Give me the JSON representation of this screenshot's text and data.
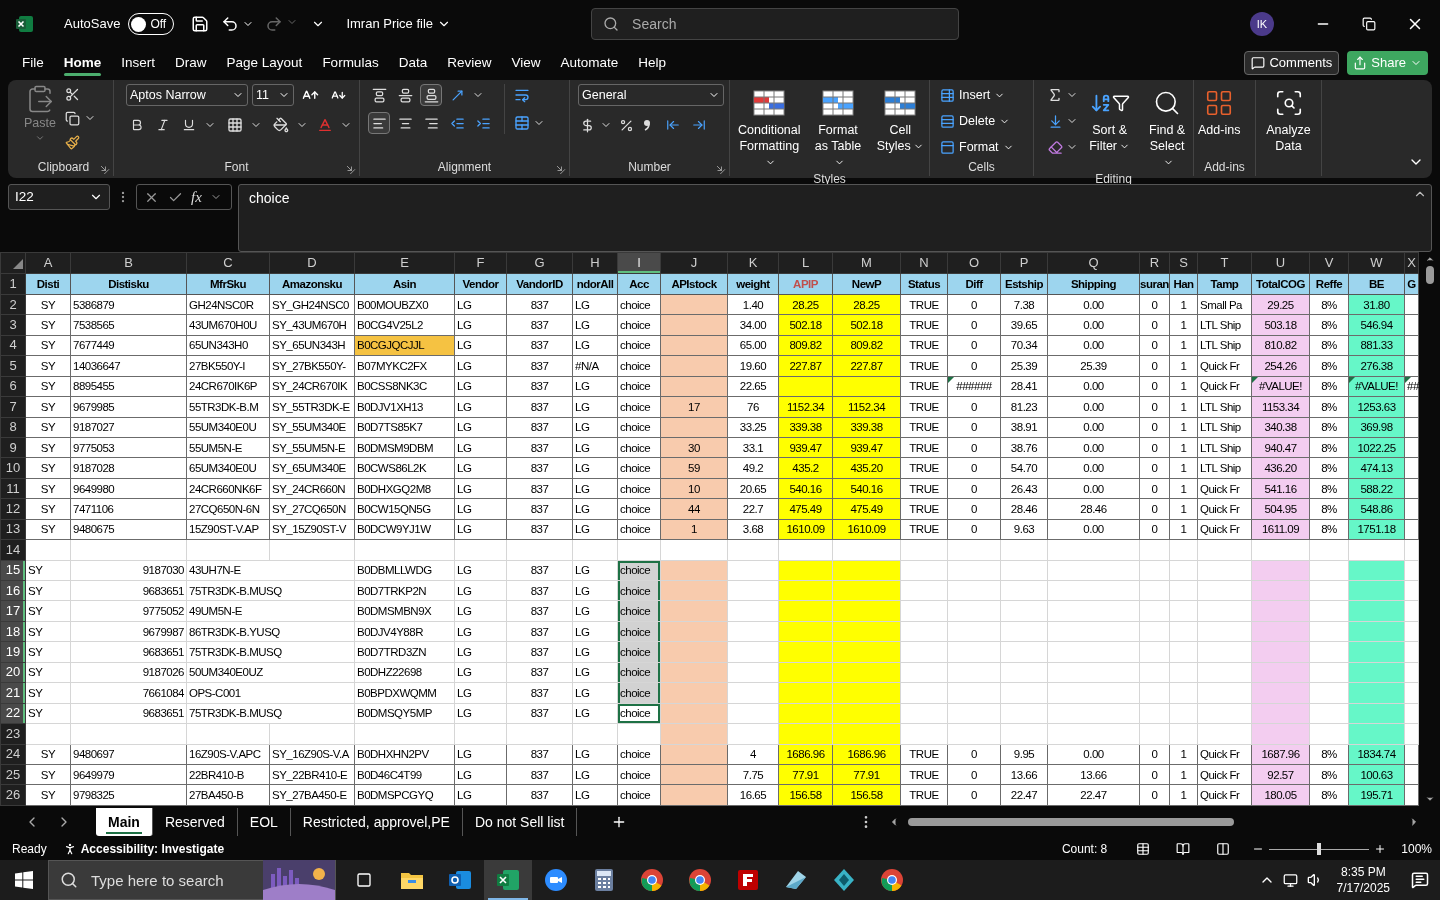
{
  "titlebar": {
    "autosave_label": "AutoSave",
    "autosave_on": false,
    "autosave_state": "Off",
    "file_name": "Imran Price file",
    "search_placeholder": "Search",
    "avatar_initials": "IK"
  },
  "menu_tabs": [
    {
      "label": "File",
      "selected": false
    },
    {
      "label": "Home",
      "selected": true
    },
    {
      "label": "Insert",
      "selected": false
    },
    {
      "label": "Draw",
      "selected": false
    },
    {
      "label": "Page Layout",
      "selected": false
    },
    {
      "label": "Formulas",
      "selected": false
    },
    {
      "label": "Data",
      "selected": false
    },
    {
      "label": "Review",
      "selected": false
    },
    {
      "label": "View",
      "selected": false
    },
    {
      "label": "Automate",
      "selected": false
    },
    {
      "label": "Help",
      "selected": false
    }
  ],
  "comments_button": "Comments",
  "share_button": "Share",
  "ribbon": {
    "clipboard": {
      "title": "Clipboard",
      "paste": "Paste"
    },
    "font": {
      "title": "Font",
      "font_name": "Aptos Narrow",
      "font_size": "11"
    },
    "alignment": {
      "title": "Alignment"
    },
    "number": {
      "title": "Number",
      "format": "General"
    },
    "styles": {
      "title": "Styles",
      "buttons": [
        "Conditional Formatting",
        "Format as Table",
        "Cell Styles"
      ]
    },
    "cells": {
      "title": "Cells",
      "buttons": [
        "Insert",
        "Delete",
        "Format"
      ]
    },
    "editing": {
      "title": "Editing",
      "buttons": [
        "Sort & Filter",
        "Find & Select"
      ]
    },
    "addins": {
      "title": "Add-ins",
      "button": "Add-ins"
    },
    "analyze": {
      "button": "Analyze Data"
    }
  },
  "formula_bar": {
    "name_box": "I22",
    "fx": "fx",
    "formula": "choice"
  },
  "grid": {
    "header_row_number": "1",
    "columns": [
      {
        "letter": "A",
        "header": "Disti",
        "selected": false
      },
      {
        "letter": "B",
        "header": "Distisku",
        "selected": false
      },
      {
        "letter": "C",
        "header": "MfrSku",
        "selected": false
      },
      {
        "letter": "D",
        "header": "Amazonsku",
        "selected": false
      },
      {
        "letter": "E",
        "header": "Asin",
        "selected": false
      },
      {
        "letter": "F",
        "header": "Vendor",
        "selected": false
      },
      {
        "letter": "G",
        "header": "VandorID",
        "selected": false
      },
      {
        "letter": "H",
        "header": "ndorAll",
        "selected": false
      },
      {
        "letter": "I",
        "header": "Acc",
        "selected": true
      },
      {
        "letter": "J",
        "header": "APIstock",
        "selected": false,
        "color": "#f8cbad"
      },
      {
        "letter": "K",
        "header": "weight",
        "selected": false
      },
      {
        "letter": "L",
        "header": {
          "text": "APIP",
          "color": "#c0504d"
        },
        "selected": false,
        "color": "#ffff00"
      },
      {
        "letter": "M",
        "header": "NewP",
        "selected": false,
        "color": "#ffff00"
      },
      {
        "letter": "N",
        "header": "Status",
        "selected": false
      },
      {
        "letter": "O",
        "header": "Diff",
        "selected": false
      },
      {
        "letter": "P",
        "header": "Estship",
        "selected": false
      },
      {
        "letter": "Q",
        "header": "Shipping",
        "selected": false
      },
      {
        "letter": "R",
        "header": "suran",
        "selected": false
      },
      {
        "letter": "S",
        "header": "Han",
        "selected": false
      },
      {
        "letter": "T",
        "header": "Tamp",
        "selected": false
      },
      {
        "letter": "U",
        "header": "TotalCOG",
        "selected": false,
        "color": "#f3cdf0"
      },
      {
        "letter": "V",
        "header": "Reffe",
        "selected": false
      },
      {
        "letter": "W",
        "header": "BE",
        "selected": false,
        "color": "#66f7c8"
      },
      {
        "letter": "X",
        "header": "G",
        "selected": false
      }
    ],
    "rows": [
      {
        "num": "2",
        "kind": "data",
        "filled": true,
        "selected": false,
        "active": false,
        "cells": [
          "SY",
          "5386879",
          "GH24NSC0R",
          "SY_GH24NSC0",
          "B00MOUBZX0",
          "LG",
          "837",
          "LG",
          "choice",
          "",
          "1.40",
          "28.25",
          "28.25",
          "TRUE",
          "0",
          "7.38",
          "0.00",
          "0",
          "1",
          "Small Pa",
          "29.25",
          "8%",
          "31.80"
        ]
      },
      {
        "num": "3",
        "kind": "data",
        "filled": true,
        "selected": false,
        "active": false,
        "cells": [
          "SY",
          "7538565",
          "43UM670H0U",
          "SY_43UM670H",
          "B0CG4V25L2",
          "LG",
          "837",
          "LG",
          "choice",
          "",
          "34.00",
          "502.18",
          "502.18",
          "TRUE",
          "0",
          "39.65",
          "0.00",
          "0",
          "1",
          "LTL Ship",
          "503.18",
          "8%",
          "546.94"
        ]
      },
      {
        "num": "4",
        "kind": "data",
        "filled": true,
        "selected": false,
        "active": false,
        "cells": [
          "SY",
          "7677449",
          "65UN343H0",
          "SY_65UN343H",
          {
            "text": "B0CGJQCJJL",
            "color": "#f5c242"
          },
          "LG",
          "837",
          "LG",
          "choice",
          "",
          "65.00",
          "809.82",
          "809.82",
          "TRUE",
          "0",
          "70.34",
          "0.00",
          "0",
          "1",
          "LTL Ship",
          "810.82",
          "8%",
          "881.33"
        ]
      },
      {
        "num": "5",
        "kind": "data",
        "filled": true,
        "selected": false,
        "active": false,
        "cells": [
          "SY",
          "14036647",
          "27BK550Y-I",
          "SY_27BK550Y-",
          "B07MYKC2FX",
          "LG",
          "837",
          "#N/A",
          "choice",
          "",
          "19.60",
          "227.87",
          "227.87",
          "TRUE",
          "0",
          "25.39",
          "25.39",
          "0",
          "1",
          "Quick Fr",
          "254.26",
          "8%",
          "276.38"
        ]
      },
      {
        "num": "6",
        "kind": "data",
        "filled": true,
        "selected": false,
        "active": false,
        "cells": [
          "SY",
          "8895455",
          "24CR670IK6P",
          "SY_24CR670IK",
          "B0CSS8NK3C",
          "LG",
          "837",
          "LG",
          "choice",
          "",
          "22.65",
          "",
          "",
          "TRUE",
          {
            "text": "######",
            "flag": true
          },
          "28.41",
          "0.00",
          "0",
          "1",
          "Quick Fr",
          {
            "text": "#VALUE!",
            "flag": true
          },
          "8%",
          {
            "text": "#VALUE!",
            "flag": true
          },
          {
            "text": "##",
            "flag": true
          }
        ]
      },
      {
        "num": "7",
        "kind": "data",
        "filled": true,
        "selected": false,
        "active": false,
        "cells": [
          "SY",
          "9679985",
          "55TR3DK-B.M",
          "SY_55TR3DK-E",
          "B0DJV1XH13",
          "LG",
          "837",
          "LG",
          "choice",
          "17",
          "76",
          "1152.34",
          "1152.34",
          "TRUE",
          "0",
          "81.23",
          "0.00",
          "0",
          "1",
          "LTL Ship",
          "1153.34",
          "8%",
          "1253.63"
        ]
      },
      {
        "num": "8",
        "kind": "data",
        "filled": true,
        "selected": false,
        "active": false,
        "cells": [
          "SY",
          "9187027",
          "55UM340E0U",
          "SY_55UM340E",
          "B0D7TS85K7",
          "LG",
          "837",
          "LG",
          "choice",
          "",
          "33.25",
          "339.38",
          "339.38",
          "TRUE",
          "0",
          "38.91",
          "0.00",
          "0",
          "1",
          "LTL Ship",
          "340.38",
          "8%",
          "369.98"
        ]
      },
      {
        "num": "9",
        "kind": "data",
        "filled": true,
        "selected": false,
        "active": false,
        "cells": [
          "SY",
          "9775053",
          "55UM5N-E",
          "SY_55UM5N-E",
          "B0DMSM9DBM",
          "LG",
          "837",
          "LG",
          "choice",
          "30",
          "33.1",
          "939.47",
          "939.47",
          "TRUE",
          "0",
          "38.76",
          "0.00",
          "0",
          "1",
          "LTL Ship",
          "940.47",
          "8%",
          "1022.25"
        ]
      },
      {
        "num": "10",
        "kind": "data",
        "filled": true,
        "selected": false,
        "active": false,
        "cells": [
          "SY",
          "9187028",
          "65UM340E0U",
          "SY_65UM340E",
          "B0CWS86L2K",
          "LG",
          "837",
          "LG",
          "choice",
          "59",
          "49.2",
          "435.2",
          "435.20",
          "TRUE",
          "0",
          "54.70",
          "0.00",
          "0",
          "1",
          "LTL Ship",
          "436.20",
          "8%",
          "474.13"
        ]
      },
      {
        "num": "11",
        "kind": "data",
        "filled": true,
        "selected": false,
        "active": false,
        "cells": [
          "SY",
          "9649980",
          "24CR660NK6F",
          "SY_24CR660N",
          "B0DHXGQ2M8",
          "LG",
          "837",
          "LG",
          "choice",
          "10",
          "20.65",
          "540.16",
          "540.16",
          "TRUE",
          "0",
          "26.43",
          "0.00",
          "0",
          "1",
          "Quick Fr",
          "541.16",
          "8%",
          "588.22"
        ]
      },
      {
        "num": "12",
        "kind": "data",
        "filled": true,
        "selected": false,
        "active": false,
        "cells": [
          "SY",
          "7471106",
          "27CQ650N-6N",
          "SY_27CQ650N",
          "B0CW15QN5G",
          "LG",
          "837",
          "LG",
          "choice",
          "44",
          "22.7",
          "475.49",
          "475.49",
          "TRUE",
          "0",
          "28.46",
          "28.46",
          "0",
          "1",
          "Quick Fr",
          "504.95",
          "8%",
          "548.86"
        ]
      },
      {
        "num": "13",
        "kind": "data",
        "filled": true,
        "selected": false,
        "active": false,
        "cells": [
          "SY",
          "9480675",
          "15Z90ST-V.AP",
          "SY_15Z90ST-V",
          "B0DCW9YJ1W",
          "LG",
          "837",
          "LG",
          "choice",
          "1",
          "3.68",
          "1610.09",
          "1610.09",
          "TRUE",
          "0",
          "9.63",
          "0.00",
          "0",
          "1",
          "Quick Fr",
          "1611.09",
          "8%",
          "1751.18"
        ]
      },
      {
        "num": "14",
        "kind": "blank",
        "filled": false,
        "selected": false,
        "active": false
      },
      {
        "num": "15",
        "kind": "pasted",
        "filled": true,
        "selected": true,
        "active": false,
        "cells": [
          "SY",
          "9187030",
          "43UH7N-E",
          "B0DBMLLWDG",
          "LG",
          "837",
          "LG",
          "choice"
        ]
      },
      {
        "num": "16",
        "kind": "pasted",
        "filled": true,
        "selected": true,
        "active": false,
        "cells": [
          "SY",
          "9683651",
          "75TR3DK-B.MUSQ",
          "B0D7TRKP2N",
          "LG",
          "837",
          "LG",
          "choice"
        ]
      },
      {
        "num": "17",
        "kind": "pasted",
        "filled": true,
        "selected": true,
        "active": false,
        "cells": [
          "SY",
          "9775052",
          "49UM5N-E",
          "B0DMSMBN9X",
          "LG",
          "837",
          "LG",
          "choice"
        ]
      },
      {
        "num": "18",
        "kind": "pasted",
        "filled": true,
        "selected": true,
        "active": false,
        "cells": [
          "SY",
          "9679987",
          "86TR3DK-B.YUSQ",
          "B0DJV4Y88R",
          "LG",
          "837",
          "LG",
          "choice"
        ]
      },
      {
        "num": "19",
        "kind": "pasted",
        "filled": true,
        "selected": true,
        "active": false,
        "cells": [
          "SY",
          "9683651",
          "75TR3DK-B.MUSQ",
          "B0D7TRD3ZN",
          "LG",
          "837",
          "LG",
          "choice"
        ]
      },
      {
        "num": "20",
        "kind": "pasted",
        "filled": true,
        "selected": true,
        "active": false,
        "cells": [
          "SY",
          "9187026",
          "50UM340E0UZ",
          "B0DHZ22698",
          "LG",
          "837",
          "LG",
          "choice"
        ]
      },
      {
        "num": "21",
        "kind": "pasted",
        "filled": true,
        "selected": true,
        "active": false,
        "cells": [
          "SY",
          "7661084",
          "OPS-C001",
          "B0BPDXWQMM",
          "LG",
          "837",
          "LG",
          "choice"
        ]
      },
      {
        "num": "22",
        "kind": "pasted",
        "filled": true,
        "selected": true,
        "active": true,
        "cells": [
          "SY",
          "9683651",
          "75TR3DK-B.MUSQ",
          "B0DMSQY5MP",
          "LG",
          "837",
          "LG",
          "choice"
        ]
      },
      {
        "num": "23",
        "kind": "blank",
        "filled": true,
        "selected": false,
        "active": false
      },
      {
        "num": "24",
        "kind": "data",
        "filled": true,
        "selected": false,
        "active": false,
        "cells": [
          "SY",
          "9480697",
          "16Z90S-V.APC",
          "SY_16Z90S-V.A",
          "B0DHXHN2PV",
          "LG",
          "837",
          "LG",
          "choice",
          "",
          "4",
          "1686.96",
          "1686.96",
          "TRUE",
          "0",
          "9.95",
          "0.00",
          "0",
          "1",
          "Quick Fr",
          "1687.96",
          "8%",
          "1834.74"
        ]
      },
      {
        "num": "25",
        "kind": "data",
        "filled": true,
        "selected": false,
        "active": false,
        "cells": [
          "SY",
          "9649979",
          "22BR410-B",
          "SY_22BR410-E",
          "B0D46C4T99",
          "LG",
          "837",
          "LG",
          "choice",
          "",
          "7.75",
          "77.91",
          "77.91",
          "TRUE",
          "0",
          "13.66",
          "13.66",
          "0",
          "1",
          "Quick Fr",
          "92.57",
          "8%",
          "100.63"
        ]
      },
      {
        "num": "26",
        "kind": "data",
        "filled": true,
        "selected": false,
        "active": false,
        "cells": [
          "SY",
          "9798325",
          "27BA450-B",
          "SY_27BA450-E",
          "B0DMSPCGYQ",
          "LG",
          "837",
          "LG",
          "choice",
          "",
          "16.65",
          "156.58",
          "156.58",
          "TRUE",
          "0",
          "22.47",
          "22.47",
          "0",
          "1",
          "Quick Fr",
          "180.05",
          "8%",
          "195.71"
        ]
      }
    ]
  },
  "sheet_tabs": [
    {
      "label": "Main",
      "selected": true
    },
    {
      "label": "Reserved",
      "selected": false
    },
    {
      "label": "EOL",
      "selected": false
    },
    {
      "label": "Restricted, approvel,PE",
      "selected": false
    },
    {
      "label": "Do not Sell list",
      "selected": false
    }
  ],
  "status_bar": {
    "ready": "Ready",
    "accessibility": "Accessibility: Investigate",
    "count": "Count: 8",
    "zoom": "100%",
    "zoom_slider": {
      "level": 0.5
    }
  },
  "taskbar": {
    "search_placeholder": "Type here to search",
    "time": "8:35 PM",
    "date": "7/17/2025",
    "apps": [
      {
        "kind": "explorer",
        "active": false
      },
      {
        "kind": "outlook",
        "active": false
      },
      {
        "kind": "excel",
        "active": true
      },
      {
        "kind": "zoom",
        "active": false
      },
      {
        "kind": "calculator",
        "active": false
      },
      {
        "kind": "chrome",
        "active": false
      },
      {
        "kind": "chrome",
        "active": false
      },
      {
        "kind": "filezilla",
        "active": false
      },
      {
        "kind": "wing",
        "active": false
      },
      {
        "kind": "cube",
        "active": false
      },
      {
        "kind": "chrome",
        "active": false
      }
    ]
  }
}
